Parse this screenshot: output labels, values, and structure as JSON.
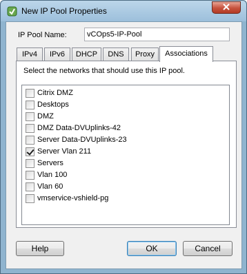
{
  "window": {
    "title": "New IP Pool Properties",
    "close_glyph": "✕"
  },
  "form": {
    "name_label": "IP Pool Name:",
    "name_value": "vCOps5-IP-Pool"
  },
  "tabs": [
    {
      "label": "IPv4",
      "active": false
    },
    {
      "label": "IPv6",
      "active": false
    },
    {
      "label": "DHCP",
      "active": false
    },
    {
      "label": "DNS",
      "active": false
    },
    {
      "label": "Proxy",
      "active": false
    },
    {
      "label": "Associations",
      "active": true
    }
  ],
  "associations": {
    "instruction": "Select the networks that should use this IP pool.",
    "networks": [
      {
        "label": "Citrix DMZ",
        "checked": false
      },
      {
        "label": "Desktops",
        "checked": false
      },
      {
        "label": "DMZ",
        "checked": false
      },
      {
        "label": "DMZ Data-DVUplinks-42",
        "checked": false
      },
      {
        "label": "Server Data-DVUplinks-23",
        "checked": false
      },
      {
        "label": "Server Vlan 211",
        "checked": true
      },
      {
        "label": "Servers",
        "checked": false
      },
      {
        "label": "Vlan 100",
        "checked": false
      },
      {
        "label": "Vlan 60",
        "checked": false
      },
      {
        "label": "vmservice-vshield-pg",
        "checked": false
      }
    ]
  },
  "buttons": {
    "help": "Help",
    "ok": "OK",
    "cancel": "Cancel"
  },
  "colors": {
    "title_bar": "#9cbfdb",
    "close_button": "#c7513c",
    "dialog_bg": "#f0f0f0"
  }
}
